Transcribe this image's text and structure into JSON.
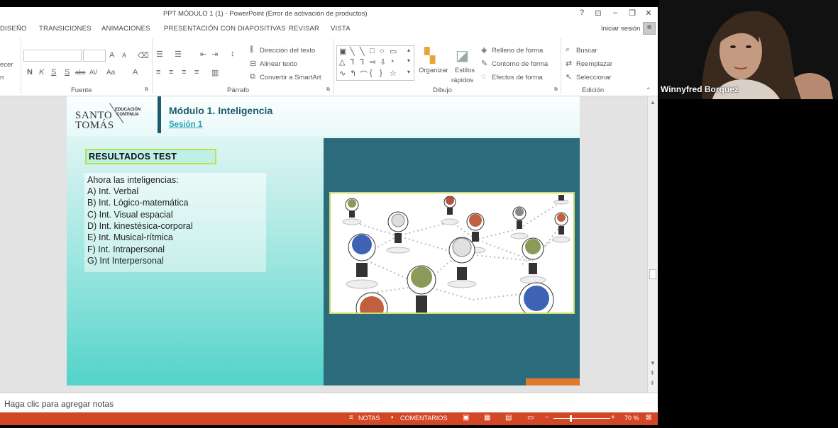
{
  "window": {
    "title": "PPT MÓDULO 1 (1) - PowerPoint (Error de activación de productos)",
    "help": "?",
    "controls": [
      "⊡",
      "–",
      "🗗",
      "✕"
    ]
  },
  "tabs": [
    "DISEÑO",
    "TRANSICIONES",
    "ANIMACIONES",
    "PRESENTACIÓN CON DIAPOSITIVAS",
    "REVISAR",
    "VISTA"
  ],
  "signin": "Iniciar sesión",
  "ribbon": {
    "left_partial": [
      "ecer",
      "n"
    ],
    "font": {
      "bold": "N",
      "italic": "K",
      "underline": "S",
      "strike": "S",
      "abc": "abc",
      "av": "AV",
      "case": "Aa",
      "fontcolor": "A",
      "grow": "A",
      "shrink": "A",
      "label": "Fuente"
    },
    "paragraph": {
      "text_direction": "Dirección del texto",
      "align_text": "Alinear texto",
      "smartart": "Convertir a SmartArt",
      "label": "Párrafo"
    },
    "drawing": {
      "organize": "Organizar",
      "quick_styles_1": "Estilos",
      "quick_styles_2": "rápidos",
      "fill": "Relleno de forma",
      "outline": "Contorno de forma",
      "effects": "Efectos de forma",
      "label": "Dibujo"
    },
    "editing": {
      "find": "Buscar",
      "replace": "Reemplazar",
      "select": "Seleccionar",
      "label": "Edición"
    }
  },
  "slide": {
    "logo_main_1": "SANTO",
    "logo_main_2": "TOMÁS",
    "logo_sub_1": "EDUCACIÓN",
    "logo_sub_2": "CONTINUA",
    "module_title": "Módulo 1. Inteligencia",
    "session": "Sesión 1",
    "results_heading": "RESULTADOS TEST",
    "intro": "Ahora las inteligencias:",
    "items": [
      "A) Int. Verbal",
      "B)  Int. Lógico-matemática",
      "C)  Int. Visual espacial",
      "D) Int. kinestésica-corporal",
      "E)  Int. Musical-rítmica",
      "F) Int. Intrapersonal",
      "G) Int Interpersonal"
    ],
    "image_alt": "brain-lightbulbs-network",
    "colors": {
      "teal_dark": "#2b6b7b",
      "accent_orange": "#e07a2d",
      "title_blue": "#1e5a6b",
      "link_blue": "#2aa2b8"
    }
  },
  "notes_placeholder": "Haga clic para agregar notas",
  "statusbar": {
    "notes": "NOTAS",
    "comments": "COMENTARIOS",
    "zoom": "70 %",
    "color": "#d24726"
  },
  "webcam": {
    "participant_name": "Winnyfred Borquez"
  }
}
